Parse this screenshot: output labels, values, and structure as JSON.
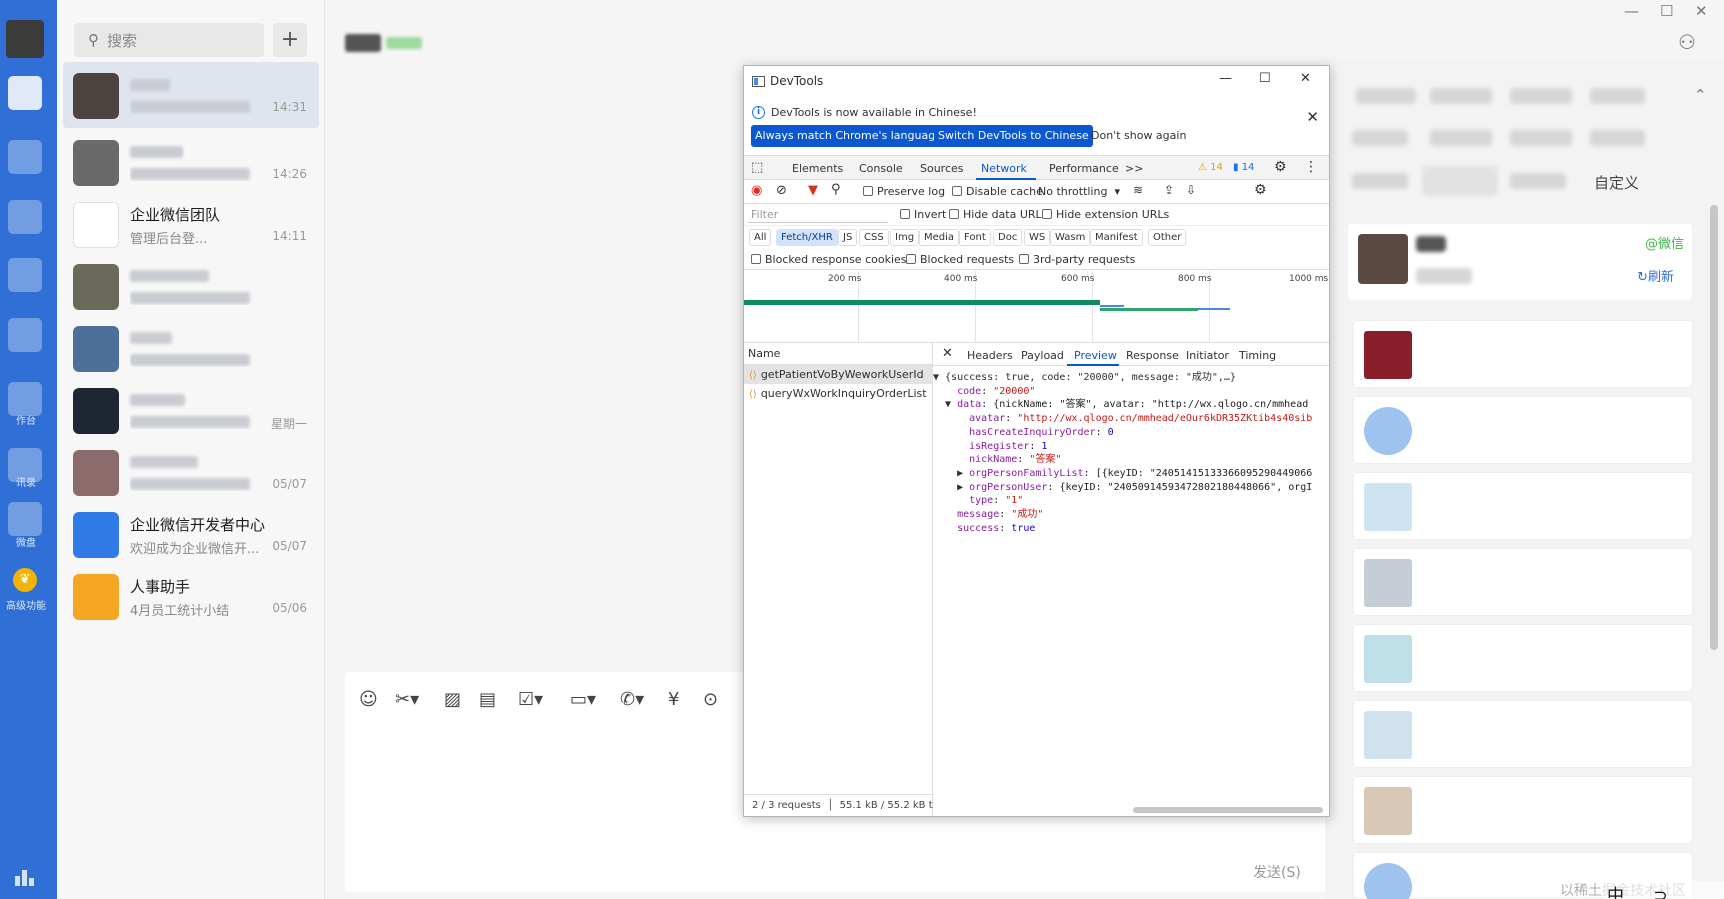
{
  "chatlist": {
    "search_placeholder": "搜索",
    "add_label": "+",
    "conversations": [
      {
        "name": "",
        "preview": "",
        "time": "14:31",
        "avatar_color": "#4b4440"
      },
      {
        "name": "",
        "preview": "",
        "time": "14:26",
        "avatar_color": "#6a6a6a"
      },
      {
        "name": "企业微信团队",
        "preview": "管理后台登...",
        "time": "14:11",
        "avatar_color": "#ffffff"
      },
      {
        "name": "",
        "preview": "",
        "time": "",
        "avatar_color": "#6b6a5a"
      },
      {
        "name": "",
        "preview": "",
        "time": "",
        "avatar_color": "#4f6f9b"
      },
      {
        "name": "",
        "preview": "",
        "time": "星期一",
        "avatar_color": "#1e2533"
      },
      {
        "name": "",
        "preview": "",
        "time": "05/07",
        "avatar_color": "#8b6b6b"
      },
      {
        "name": "企业微信开发者中心",
        "preview": "欢迎成为企业微信开...",
        "time": "05/07",
        "avatar_color": "#2f7ae5"
      },
      {
        "name": "人事助手",
        "preview": "4月员工统计小结",
        "time": "05/06",
        "avatar_color": "#f5a623"
      }
    ]
  },
  "rail": {
    "labels": [
      "作台",
      "讯录",
      "微盘",
      "高级功能"
    ]
  },
  "composer": {
    "send_label": "发送(S)"
  },
  "rpanel": {
    "custom_label": "自定义",
    "wechat_tag": "@微信",
    "refresh_label": "刷新"
  },
  "devtools": {
    "title": "DevTools",
    "info_message": "DevTools is now available in Chinese!",
    "btn_match": "Always match Chrome's language",
    "btn_switch": "Switch DevTools to Chinese",
    "btn_dont_show": "Don't show again",
    "tabs": [
      "Elements",
      "Console",
      "Sources",
      "Network",
      "Performance"
    ],
    "more_tabs": ">>",
    "warnings_count": "14",
    "messages_count": "14",
    "toolbar": {
      "preserve_log": "Preserve log",
      "disable_cache": "Disable cache",
      "throttling": "No throttling"
    },
    "filter": {
      "placeholder": "Filter",
      "invert": "Invert",
      "hide_data_urls": "Hide data URLs",
      "hide_extension_urls": "Hide extension URLs"
    },
    "chips": [
      "All",
      "Fetch/XHR",
      "JS",
      "CSS",
      "Img",
      "Media",
      "Font",
      "Doc",
      "WS",
      "Wasm",
      "Manifest",
      "Other"
    ],
    "blocked": {
      "cookies": "Blocked response cookies",
      "requests": "Blocked requests",
      "third_party": "3rd-party requests"
    },
    "timeline_ticks": [
      "200 ms",
      "400 ms",
      "600 ms",
      "800 ms",
      "1000 ms"
    ],
    "name_header": "Name",
    "requests": [
      "getPatientVoByWeworkUserId",
      "queryWxWorkInquiryOrderList"
    ],
    "status_requests": "2 / 3 requests",
    "status_size": "55.1 kB / 55.2 kB t",
    "detail_tabs": [
      "Headers",
      "Payload",
      "Preview",
      "Response",
      "Initiator",
      "Timing"
    ],
    "preview_lines": [
      "▼ {success: true, code: \"20000\", message: \"成功\",…}",
      "    code: \"20000\"",
      "  ▼ data: {nickName: \"答案\", avatar: \"http://wx.qlogo.cn/mmhead",
      "      avatar: \"http://wx.qlogo.cn/mmhead/eOur6kDR35ZKtib4s40sib",
      "      hasCreateInquiryOrder: 0",
      "      isRegister: 1",
      "      nickName: \"答案\"",
      "    ▶ orgPersonFamilyList: [{keyID: \"24051415133366095290449066",
      "    ▶ orgPersonUser: {keyID: \"24050914593472802180448066\", orgI",
      "      type: \"1\"",
      "    message: \"成功\"",
      "    success: true"
    ]
  },
  "watermark": "以稀土掘金技术社区",
  "ime_text": "中 ⊃ ，"
}
